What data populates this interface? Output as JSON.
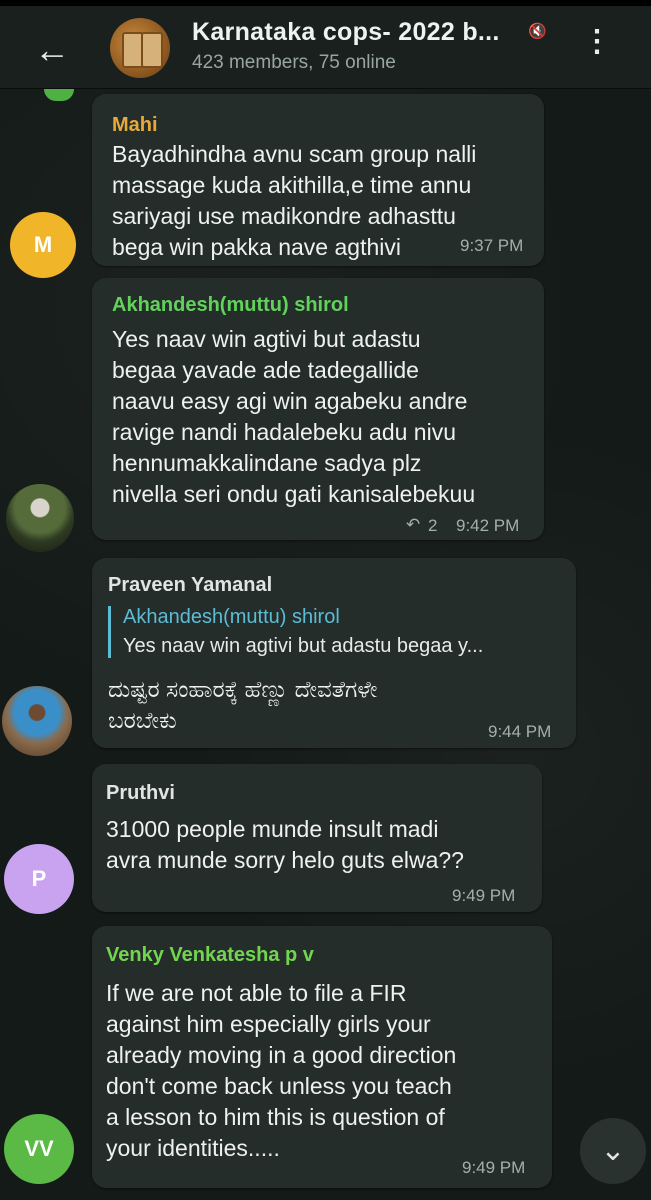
{
  "header": {
    "back_icon": "arrow-left-icon",
    "title": "Karnataka cops- 2022 b...",
    "subtitle": "423 members, 75 online",
    "mute_icon": "speaker-muted-icon",
    "menu_icon": "more-vertical-icon"
  },
  "messages": [
    {
      "sender": "Mahi",
      "sender_color": "#e7a93a",
      "avatar_letter": "M",
      "avatar_color": "#f1b52a",
      "text": "Bayadhindha avnu scam group nalli\nmassage kuda akithilla,e time annu\nsariyagi use madikondre adhasttu\nbega win pakka nave agthivi",
      "time": "9:37 PM"
    },
    {
      "sender": "Akhandesh(muttu) shirol",
      "sender_color": "#61d25a",
      "text": "Yes naav win agtivi  but adastu\nbegaa yavade ade tadegallide\nnaavu easy agi win agabeku andre\nravige nandi hadalebeku adu nivu\nhennumakkalindane sadya plz\nnivella seri ondu gati kanisalebekuu",
      "reply_count": "2",
      "time": "9:42 PM"
    },
    {
      "sender": "Praveen Yamanal",
      "sender_color": "#dfe5e3",
      "quote_name": "Akhandesh(muttu) shirol",
      "quote_text": "Yes naav win agtivi  but adastu begaa y...",
      "text": "ದುಷ್ಟರ ಸಂಹಾರಕ್ಕೆ ಹೆಣ್ಣು ದೇವತೆಗಳೇ\nಬರಬೇಕು",
      "time": "9:44 PM"
    },
    {
      "sender": "Pruthvi",
      "sender_color": "#dfe5e3",
      "avatar_letter": "P",
      "avatar_color": "#c9a3ef",
      "text": "31000 people munde insult madi\navra munde sorry helo guts elwa??",
      "time": "9:49 PM"
    },
    {
      "sender": "Venky Venkatesha p v",
      "sender_color": "#71d64e",
      "avatar_letter": "VV",
      "avatar_color": "#5bb945",
      "text": "If we are not able to file a FIR\nagainst him especially girls your\nalready moving in a good direction\ndon't come back unless you teach\na lesson to him this is question of\nyour identities.....",
      "time": "9:49 PM"
    }
  ],
  "scroll_icon": "chevron-down-icon"
}
